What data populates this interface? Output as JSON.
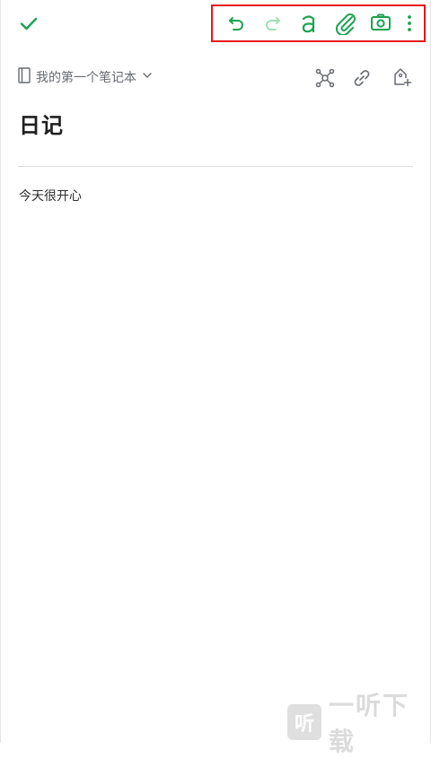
{
  "colors": {
    "accent": "#1aa251",
    "accent_disabled": "#9fe0b8",
    "muted_icon": "#666a70",
    "title": "#1f1f1f",
    "highlight_border": "#e8141a"
  },
  "toolbar": {
    "icons": [
      "check-icon",
      "undo-icon",
      "redo-icon",
      "text-format-icon",
      "attachment-icon",
      "camera-icon",
      "more-vertical-icon"
    ]
  },
  "notebook": {
    "name": "我的第一个笔记本",
    "icons": [
      "notebook-icon",
      "chevron-down-icon",
      "mindmap-icon",
      "link-icon",
      "tag-add-icon"
    ]
  },
  "note": {
    "title": "日记",
    "body": "今天很开心"
  },
  "watermark": {
    "badge": "听",
    "text": "一听下载"
  }
}
